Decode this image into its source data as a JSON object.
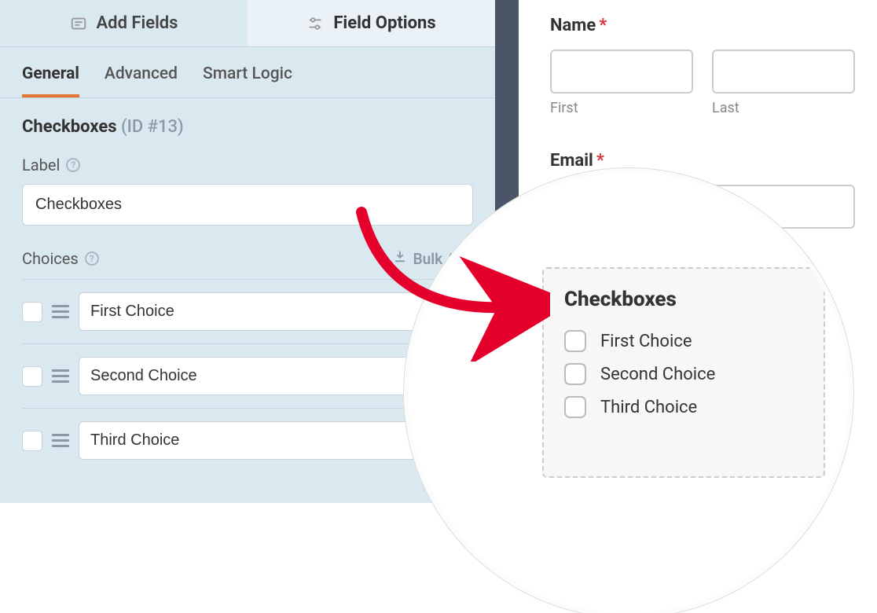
{
  "topTabs": {
    "addFields": "Add Fields",
    "fieldOptions": "Field Options"
  },
  "subTabs": {
    "general": "General",
    "advanced": "Advanced",
    "smartLogic": "Smart Logic"
  },
  "fieldTitle": {
    "name": "Checkboxes",
    "id": "(ID #13)"
  },
  "labelSection": {
    "label": "Label",
    "value": "Checkboxes"
  },
  "choicesSection": {
    "label": "Choices",
    "bulkAdd": "Bulk Add",
    "items": [
      "First Choice",
      "Second Choice",
      "Third Choice"
    ]
  },
  "preview": {
    "name": {
      "label": "Name",
      "first": "First",
      "last": "Last"
    },
    "email": {
      "label": "Email"
    },
    "checkboxes": {
      "title": "Checkboxes",
      "options": [
        "First Choice",
        "Second Choice",
        "Third Choice"
      ]
    }
  }
}
